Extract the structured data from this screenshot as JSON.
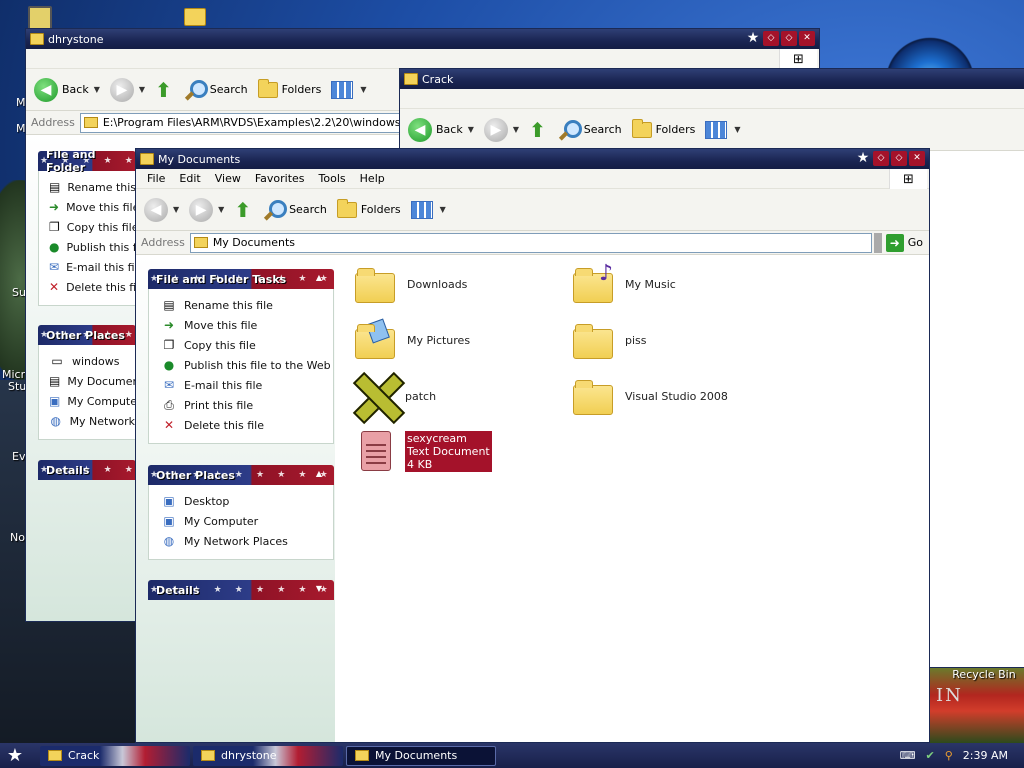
{
  "desktop": {
    "icons_left": [
      "M",
      "M",
      "Su",
      "Micro",
      "Stu",
      "Ev",
      "No"
    ],
    "recycle_bin": "Recycle Bin",
    "brand_text": "IN"
  },
  "win_dhrystone": {
    "title": "dhrystone",
    "toolbar": {
      "back": "Back",
      "search": "Search",
      "folders": "Folders"
    },
    "address_label": "Address",
    "address_value": "E:\\Program Files\\ARM\\RVDS\\Examples\\2.2\\20\\windows\\dhryst",
    "tasks_head": "File and Folder",
    "tasks": [
      "Rename this",
      "Move this file",
      "Copy this file",
      "Publish this f",
      "E-mail this file",
      "Delete this fil"
    ],
    "places_head": "Other Places",
    "places": [
      "windows",
      "My Documen",
      "My Computer",
      "My Network"
    ],
    "details_head": "Details"
  },
  "win_crack": {
    "title": "Crack",
    "toolbar": {
      "back": "Back",
      "search": "Search",
      "folders": "Folders"
    }
  },
  "win_mydocs": {
    "title": "My Documents",
    "menu": [
      "File",
      "Edit",
      "View",
      "Favorites",
      "Tools",
      "Help"
    ],
    "toolbar": {
      "search": "Search",
      "folders": "Folders"
    },
    "address_label": "Address",
    "address_value": "My Documents",
    "go_label": "Go",
    "tasks_head": "File and Folder Tasks",
    "tasks": [
      "Rename this file",
      "Move this file",
      "Copy this file",
      "Publish this file to the Web",
      "E-mail this file",
      "Print this file",
      "Delete this file"
    ],
    "places_head": "Other Places",
    "places": [
      "Desktop",
      "My Computer",
      "My Network Places"
    ],
    "details_head": "Details",
    "items": {
      "downloads": "Downloads",
      "my_music": "My Music",
      "my_pictures": "My Pictures",
      "piss": "piss",
      "patch": "patch",
      "visual_studio": "Visual Studio 2008",
      "sexycream_name": "sexycream",
      "sexycream_type": "Text Document",
      "sexycream_size": "4 KB"
    }
  },
  "taskbar": {
    "tasks": [
      "Crack",
      "dhrystone",
      "My Documents"
    ],
    "clock": "2:39 AM"
  }
}
